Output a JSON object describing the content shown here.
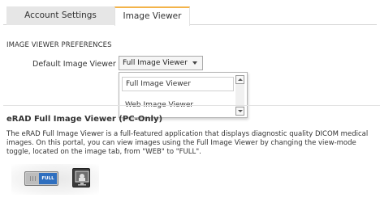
{
  "tabs": [
    {
      "label": "Account Settings",
      "active": false
    },
    {
      "label": "Image Viewer",
      "active": true
    }
  ],
  "preferences": {
    "heading": "IMAGE VIEWER PREFERENCES",
    "default_viewer_label": "Default Image Viewer",
    "default_viewer_value": "Full Image Viewer",
    "options": [
      "Full Image Viewer",
      "Web Image Viewer"
    ]
  },
  "erad_section": {
    "heading": "eRAD Full Image Viewer (PC-Only)",
    "description": "The eRAD Full Image Viewer is a full-featured application that displays diagnostic quality DICOM medical images. On this portal, you can view images using the Full Image Viewer by changing the view-mode toggle, located on the image tab, from \"WEB\" to \"FULL\"."
  },
  "toggle": {
    "full_label": "FULL"
  },
  "icons": {
    "dropdown": "chevron-down-icon",
    "viewer": "image-viewer-icon"
  },
  "colors": {
    "active_tab_accent": "#f3b34a",
    "toggle_full": "#2f6fbf"
  }
}
